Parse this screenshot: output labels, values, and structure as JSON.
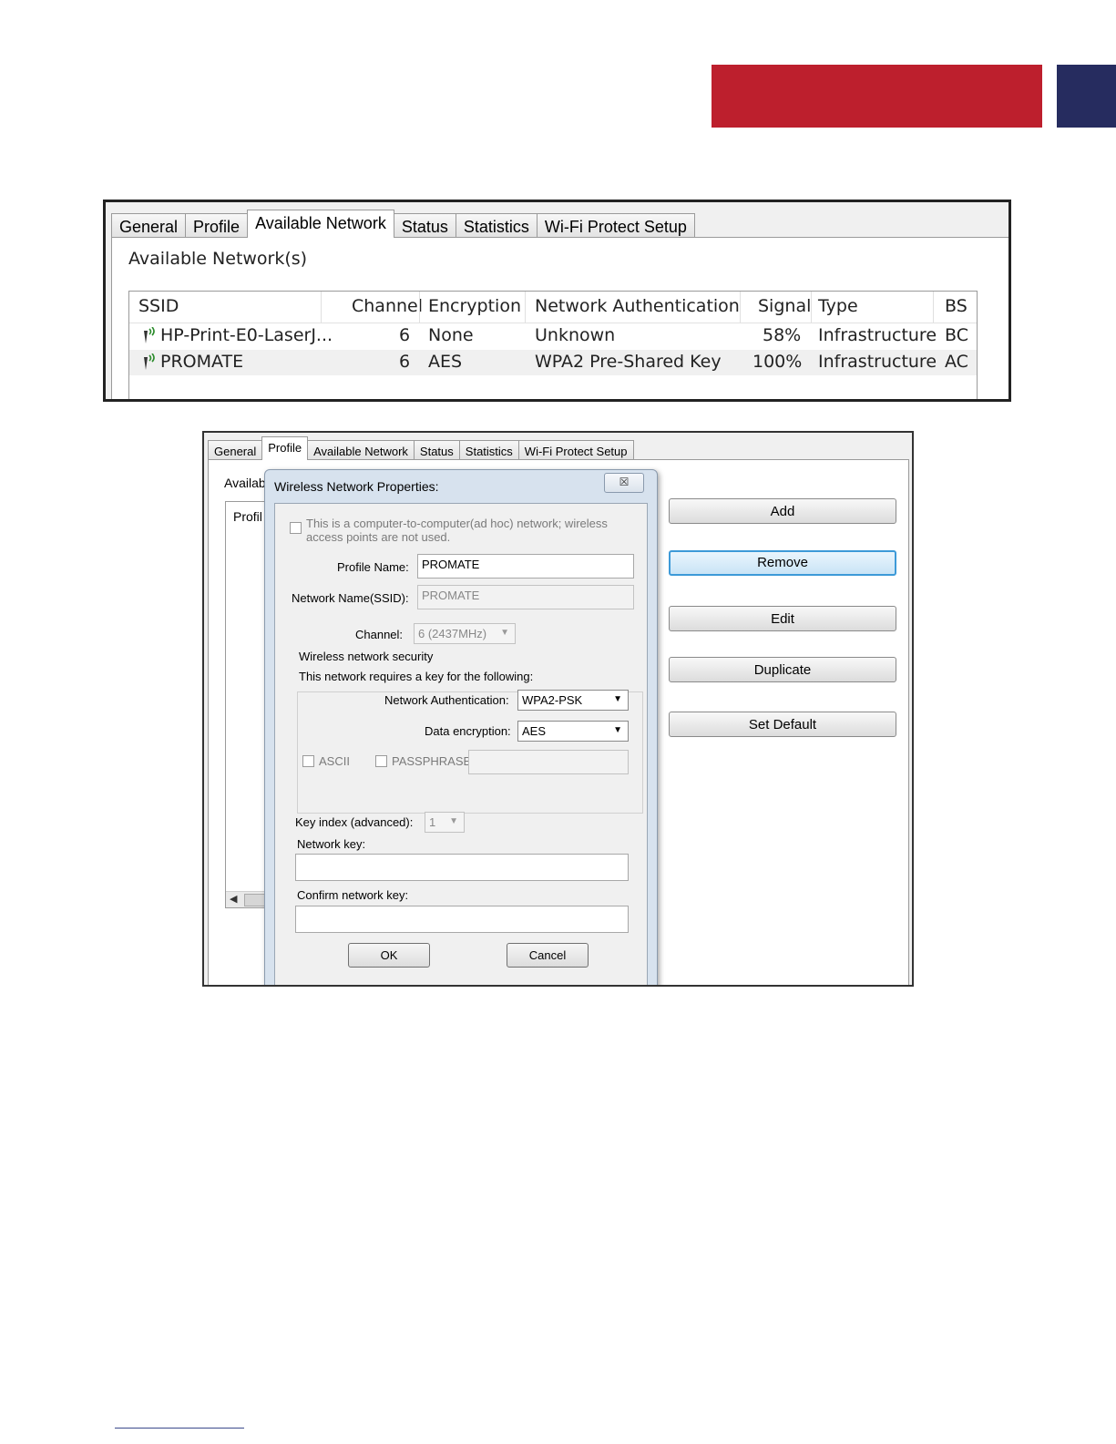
{
  "brand": {
    "red": "#bd1f2d",
    "blue": "#262c5f"
  },
  "tabs": [
    "General",
    "Profile",
    "Available Network",
    "Status",
    "Statistics",
    "Wi-Fi Protect Setup"
  ],
  "available": {
    "heading": "Available Network(s)",
    "columns": [
      "SSID",
      "Channel",
      "Encryption",
      "Network Authentication",
      "Signal",
      "Type",
      "BS"
    ],
    "rows": [
      {
        "ssid": "HP-Print-E0-LaserJ...",
        "channel": "6",
        "encryption": "None",
        "auth": "Unknown",
        "signal": "58%",
        "type": "Infrastructure",
        "bssid": "BC"
      },
      {
        "ssid": "PROMATE",
        "channel": "6",
        "encryption": "AES",
        "auth": "WPA2 Pre-Shared Key",
        "signal": "100%",
        "type": "Infrastructure",
        "bssid": "AC"
      }
    ]
  },
  "profile": {
    "avail_label": "Availab",
    "profile_col": "Profil",
    "buttons": {
      "add": "Add",
      "remove": "Remove",
      "edit": "Edit",
      "duplicate": "Duplicate",
      "set_default": "Set Default"
    }
  },
  "dialog": {
    "title": "Wireless Network Properties:",
    "close": "☒",
    "adhoc_line1": "This is a computer-to-computer(ad hoc) network; wireless",
    "adhoc_line2": "access points are not used.",
    "profile_name_label": "Profile Name:",
    "profile_name": "PROMATE",
    "ssid_label": "Network Name(SSID):",
    "ssid": "PROMATE",
    "channel_label": "Channel:",
    "channel": "6  (2437MHz)",
    "security_group": "Wireless network security",
    "requires_key": "This network requires a key for the following:",
    "auth_label": "Network Authentication:",
    "auth": "WPA2-PSK",
    "enc_label": "Data encryption:",
    "enc": "AES",
    "ascii": "ASCII",
    "passphrase": "PASSPHRASE",
    "key_index_label": "Key index (advanced):",
    "key_index": "1",
    "network_key_label": "Network key:",
    "confirm_key_label": "Confirm network key:",
    "ok": "OK",
    "cancel": "Cancel"
  }
}
